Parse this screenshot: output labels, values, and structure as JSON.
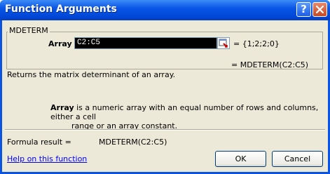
{
  "window": {
    "title": "Function Arguments"
  },
  "titlebar": {
    "help_icon": "question-mark",
    "close_icon": "x"
  },
  "function": {
    "name": "MDETERM",
    "array_label": "Array",
    "array_value": "C2:C5",
    "array_result": "= {1;2;2;0}",
    "formula_preview": "= MDETERM(C2:C5)"
  },
  "description": "Returns the matrix determinant of an array.",
  "arg_help": {
    "name": "Array",
    "text": " is a numeric array with an equal number of rows and columns, either a cell",
    "text_cont": "range or an array constant."
  },
  "result": {
    "label": "Formula result =",
    "value": "MDETERM(C2:C5)"
  },
  "footer": {
    "help_link": "Help on this function",
    "ok_label": "OK",
    "cancel_label": "Cancel"
  }
}
